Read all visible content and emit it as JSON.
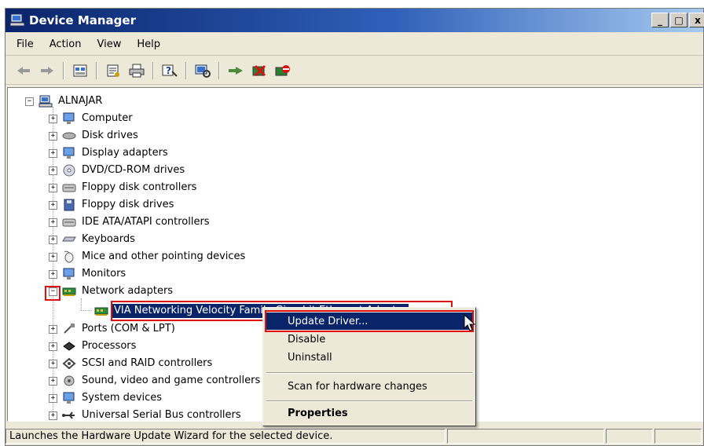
{
  "window": {
    "title": "Device Manager",
    "buttons": {
      "minimize": "_",
      "maximize": "□",
      "close": "x"
    }
  },
  "menu": [
    "File",
    "Action",
    "View",
    "Help"
  ],
  "toolbar": [
    "back-icon",
    "forward-icon",
    "view-icon",
    "properties-icon",
    "print-icon",
    "help-icon",
    "scan-icon",
    "update-driver-icon",
    "uninstall-icon",
    "disable-icon"
  ],
  "tree": {
    "root": "ALNAJAR",
    "categories": [
      "Computer",
      "Disk drives",
      "Display adapters",
      "DVD/CD-ROM drives",
      "Floppy disk controllers",
      "Floppy disk drives",
      "IDE ATA/ATAPI controllers",
      "Keyboards",
      "Mice and other pointing devices",
      "Monitors",
      "Network adapters"
    ],
    "network_device": "VIA Networking Velocity Family Giga-bit Ethernet Adapter",
    "categories_after": [
      "Ports (COM & LPT)",
      "Processors",
      "SCSI and RAID controllers",
      "Sound, video and game controllers",
      "System devices",
      "Universal Serial Bus controllers"
    ]
  },
  "context_menu": {
    "update_driver": "Update Driver...",
    "disable": "Disable",
    "uninstall": "Uninstall",
    "scan": "Scan for hardware changes",
    "properties": "Properties"
  },
  "status_text": "Launches the Hardware Update Wizard for the selected device.",
  "colors": {
    "title_start": "#0a246a",
    "title_end": "#a6caf0",
    "highlight": "#0a246a",
    "annotation": "#e01010"
  }
}
